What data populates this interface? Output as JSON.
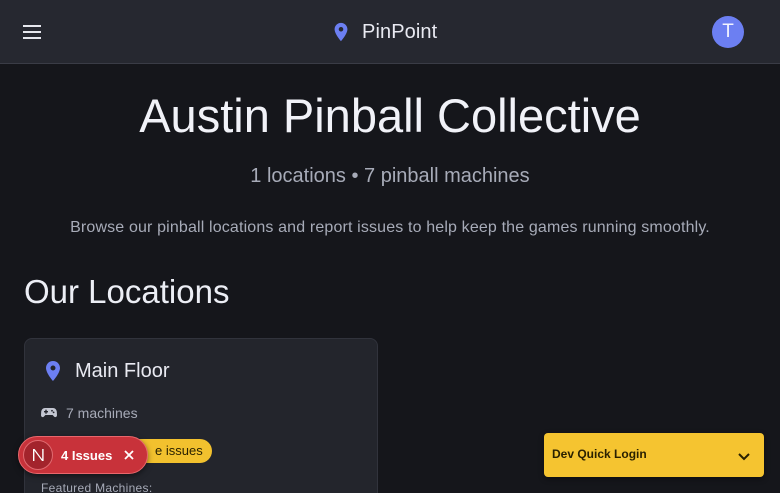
{
  "header": {
    "brand": "PinPoint",
    "avatar_initial": "T"
  },
  "hero": {
    "title": "Austin Pinball Collective",
    "stats": "1 locations • 7 pinball machines",
    "description": "Browse our pinball locations and report issues to help keep the games running smoothly."
  },
  "locations": {
    "section_title": "Our Locations",
    "cards": [
      {
        "name": "Main Floor",
        "machines": "7 machines",
        "issues_chip": "e issues",
        "featured_label": "Featured Machines:"
      }
    ]
  },
  "devtools": {
    "logo": "N",
    "issues": "4 Issues"
  },
  "quick_login": {
    "label": "Dev Quick Login"
  },
  "colors": {
    "background": "#15161b",
    "appbar": "#262830",
    "accent": "#6c7ff2",
    "card": "#23252c",
    "warning": "#f2c12e",
    "devtools": "#c8323a"
  },
  "icons": {
    "menu": "menu-icon",
    "brand": "map-pin-icon",
    "location": "map-pin-icon",
    "machines": "gamepad-icon",
    "close": "close-icon",
    "chevron": "chevron-down-icon"
  }
}
